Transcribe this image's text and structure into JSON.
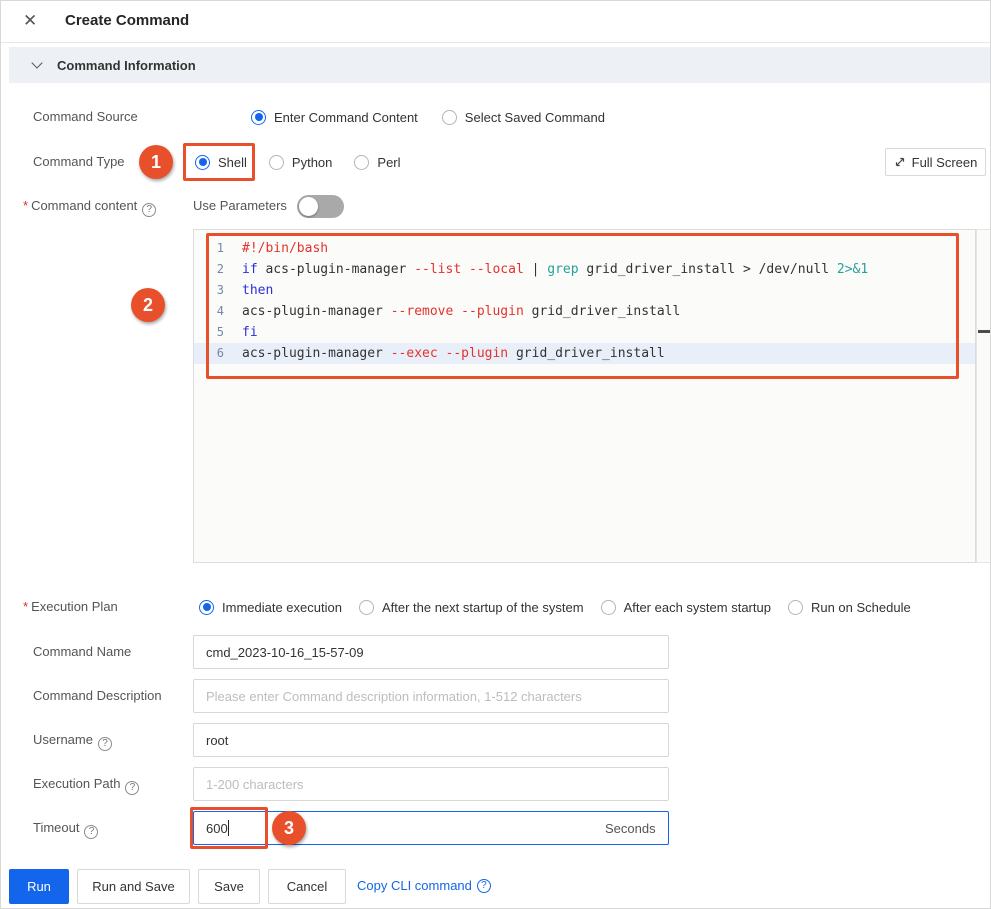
{
  "colors": {
    "accent_blue": "#1366ec",
    "annotation_orange": "#e8502c",
    "code_red": "#e5322c",
    "code_blue": "#2832d8",
    "code_teal": "#27a198"
  },
  "header": {
    "title": "Create Command",
    "close_icon": "close"
  },
  "section": {
    "title": "Command Information"
  },
  "form": {
    "command_source": {
      "label": "Command Source",
      "options": [
        {
          "label": "Enter Command Content",
          "selected": true
        },
        {
          "label": "Select Saved Command",
          "selected": false
        }
      ]
    },
    "command_type": {
      "label": "Command Type",
      "annotation_badge": "1",
      "options": [
        {
          "label": "Shell",
          "selected": true
        },
        {
          "label": "Python",
          "selected": false
        },
        {
          "label": "Perl",
          "selected": false
        }
      ]
    },
    "full_screen_button": {
      "label": "Full Screen"
    },
    "command_content": {
      "required_mark": "*",
      "label": "Command content",
      "use_parameters_label": "Use Parameters",
      "use_parameters_state": "off",
      "annotation_badge": "2"
    },
    "execution_plan": {
      "required_mark": "*",
      "label": "Execution Plan",
      "options": [
        {
          "label": "Immediate execution",
          "selected": true
        },
        {
          "label": "After the next startup of the system",
          "selected": false
        },
        {
          "label": "After each system startup",
          "selected": false
        },
        {
          "label": "Run on Schedule",
          "selected": false
        }
      ]
    },
    "command_name": {
      "label": "Command Name",
      "value": "cmd_2023-10-16_15-57-09"
    },
    "command_description": {
      "label": "Command Description",
      "placeholder": "Please enter Command description information, 1-512 characters"
    },
    "username": {
      "label": "Username",
      "value": "root"
    },
    "execution_path": {
      "label": "Execution Path",
      "placeholder": "1-200 characters"
    },
    "timeout": {
      "label": "Timeout",
      "value": "600",
      "unit": "Seconds",
      "annotation_badge": "3"
    }
  },
  "editor": {
    "lines": [
      {
        "num": "1",
        "highlighted": false,
        "tokens": [
          [
            "#!/bin/bash",
            "red"
          ]
        ]
      },
      {
        "num": "2",
        "highlighted": false,
        "tokens": [
          [
            "if ",
            "blue"
          ],
          [
            "acs-plugin-manager ",
            "def"
          ],
          [
            "--list",
            "red"
          ],
          [
            " ",
            "def"
          ],
          [
            "--local",
            "red"
          ],
          [
            " | ",
            "def"
          ],
          [
            "grep",
            "teal"
          ],
          [
            " grid_driver_install > /dev/null ",
            "def"
          ],
          [
            "2>&1",
            "teal"
          ]
        ]
      },
      {
        "num": "3",
        "highlighted": false,
        "tokens": [
          [
            "then",
            "blue"
          ]
        ]
      },
      {
        "num": "4",
        "highlighted": false,
        "tokens": [
          [
            "acs-plugin-manager ",
            "def"
          ],
          [
            "--remove",
            "red"
          ],
          [
            " ",
            "def"
          ],
          [
            "--plugin",
            "red"
          ],
          [
            " grid_driver_install",
            "def"
          ]
        ]
      },
      {
        "num": "5",
        "highlighted": false,
        "tokens": [
          [
            "fi",
            "blue"
          ]
        ]
      },
      {
        "num": "6",
        "highlighted": true,
        "tokens": [
          [
            "acs-plugin-manager ",
            "def"
          ],
          [
            "--exec",
            "red"
          ],
          [
            " ",
            "def"
          ],
          [
            "--plugin",
            "red"
          ],
          [
            " grid_driver_install",
            "def"
          ]
        ]
      }
    ]
  },
  "footer": {
    "buttons": [
      {
        "label": "Run",
        "primary": true
      },
      {
        "label": "Run and Save",
        "primary": false
      },
      {
        "label": "Save",
        "primary": false
      },
      {
        "label": "Cancel",
        "primary": false
      }
    ],
    "copy_cli_label": "Copy CLI command"
  }
}
